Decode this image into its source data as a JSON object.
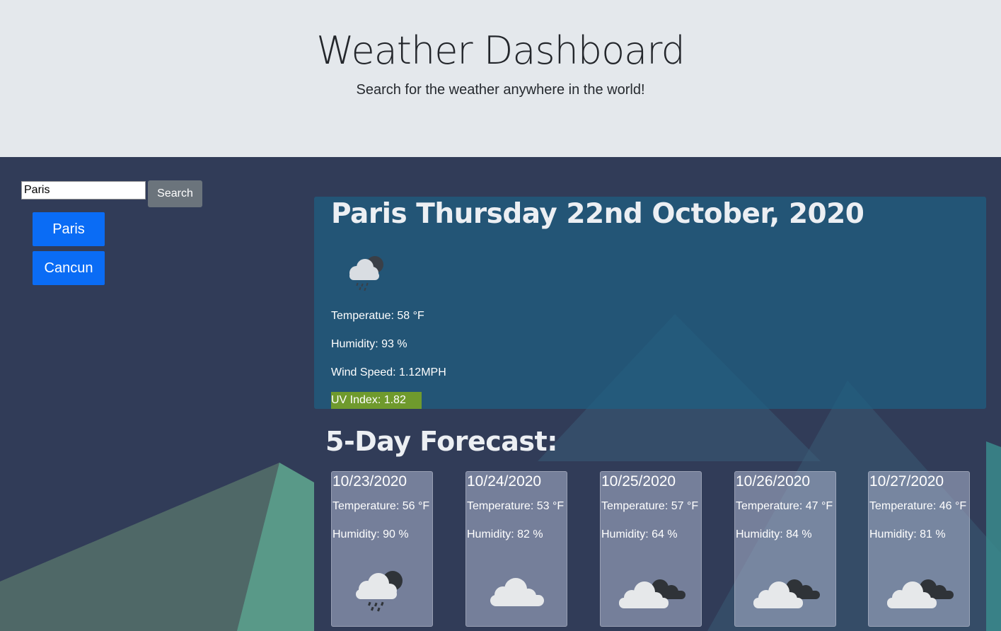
{
  "header": {
    "title": "Weather Dashboard",
    "subtitle": "Search for the weather anywhere in the world!"
  },
  "search": {
    "value": "Paris",
    "button_label": "Search"
  },
  "history": [
    {
      "label": "Paris"
    },
    {
      "label": "Cancun"
    }
  ],
  "current": {
    "title": "Paris Thursday 22nd October, 2020",
    "icon": "cloud-rain-night-icon",
    "temperature": "Temperatue: 58 °F",
    "humidity": "Humidity: 93 %",
    "wind": "Wind Speed: 1.12MPH",
    "uv": "UV Index: 1.82",
    "uv_color": "#6f9a2d"
  },
  "forecast_title": "5-Day Forecast:",
  "forecast": [
    {
      "date": "10/23/2020",
      "temperature": "Temperature: 56 °F",
      "humidity": "Humidity: 90 %",
      "icon": "cloud-rain-night-icon"
    },
    {
      "date": "10/24/2020",
      "temperature": "Temperature: 53 °F",
      "humidity": "Humidity: 82 %",
      "icon": "cloud-icon"
    },
    {
      "date": "10/25/2020",
      "temperature": "Temperature: 57 °F",
      "humidity": "Humidity: 64 %",
      "icon": "broken-clouds-icon"
    },
    {
      "date": "10/26/2020",
      "temperature": "Temperature: 47 °F",
      "humidity": "Humidity: 84 %",
      "icon": "broken-clouds-icon"
    },
    {
      "date": "10/27/2020",
      "temperature": "Temperature: 46 °F",
      "humidity": "Humidity: 81 %",
      "icon": "broken-clouds-icon"
    }
  ],
  "colors": {
    "header_bg": "#e4e8ec",
    "main_bg": "#313c58",
    "city_button": "#0a6cf5",
    "search_button": "#6b747c"
  }
}
